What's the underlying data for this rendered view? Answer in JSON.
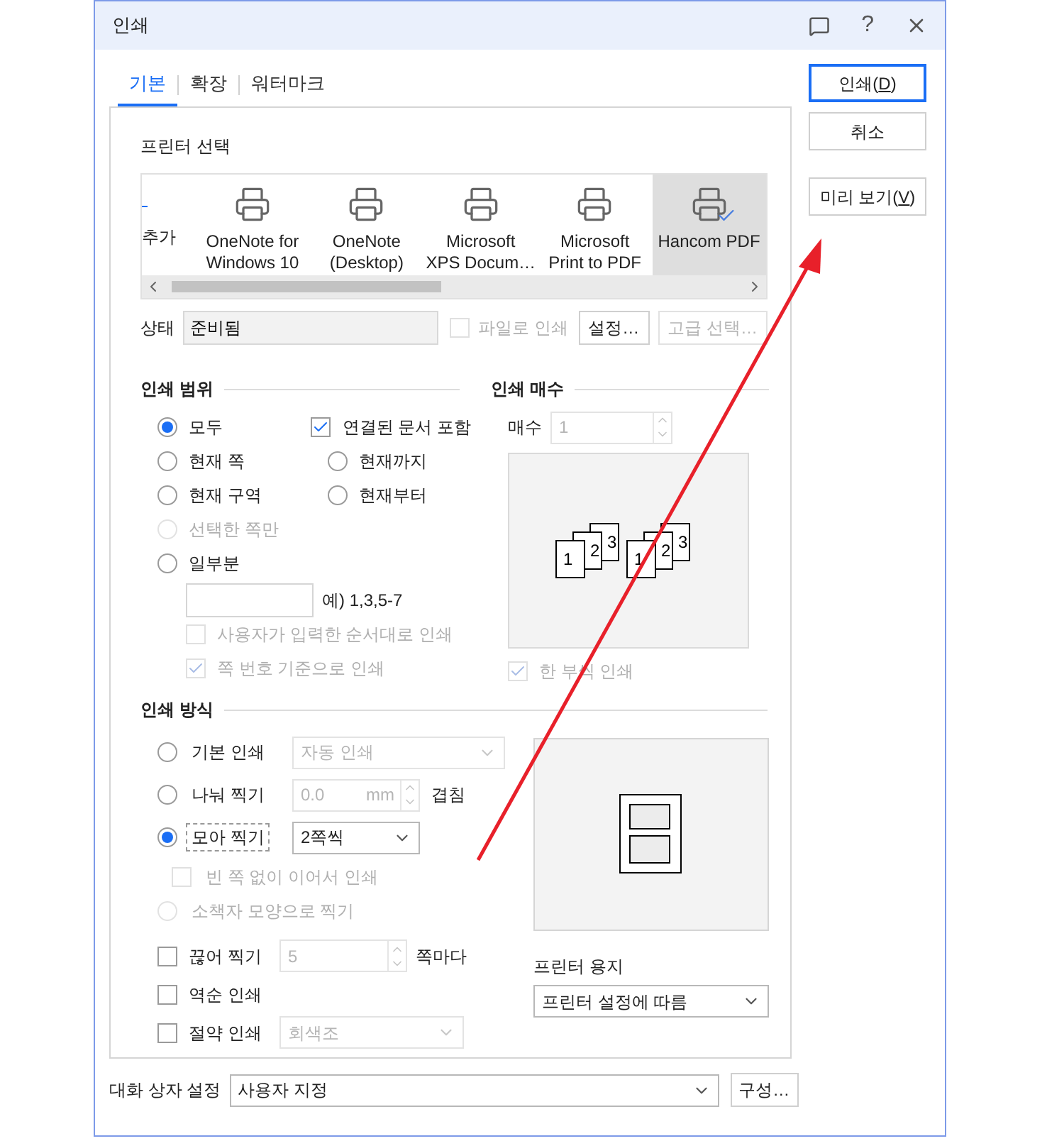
{
  "window": {
    "title": "인쇄",
    "help": "?"
  },
  "tabs": [
    {
      "label": "기본",
      "selected": true
    },
    {
      "label": "확장",
      "selected": false
    },
    {
      "label": "워터마크",
      "selected": false
    }
  ],
  "printer_select": {
    "title": "프린터 선택",
    "printers": [
      {
        "kind": "add",
        "lines": [
          "추가"
        ],
        "selected": false
      },
      {
        "kind": "printer",
        "lines": [
          "OneNote for",
          "Windows 10"
        ],
        "selected": false
      },
      {
        "kind": "printer",
        "lines": [
          "OneNote",
          "(Desktop)"
        ],
        "selected": false
      },
      {
        "kind": "printer",
        "lines": [
          "Microsoft",
          "XPS Docum…"
        ],
        "selected": false
      },
      {
        "kind": "printer",
        "lines": [
          "Microsoft",
          "Print to PDF"
        ],
        "selected": false
      },
      {
        "kind": "printer",
        "lines": [
          "Hancom PDF"
        ],
        "selected": true
      }
    ],
    "status_label": "상태",
    "status": "준비됨",
    "print_to_file": {
      "label": "파일로 인쇄",
      "checked": false,
      "disabled": true
    },
    "settings_button": {
      "label": "설정…",
      "disabled": false
    },
    "advanced_button": {
      "label": "고급 선택…",
      "disabled": true
    }
  },
  "print_range": {
    "title": "인쇄 범위",
    "rows": [
      [
        {
          "kind": "radio",
          "label": "모두",
          "selected": true,
          "disabled": false
        },
        {
          "kind": "checkbox",
          "label": "연결된 문서 포함",
          "checked": true,
          "disabled": false
        }
      ],
      [
        {
          "kind": "radio",
          "label": "현재 쪽",
          "selected": false,
          "disabled": false
        },
        {
          "kind": "radio",
          "label": "현재까지",
          "selected": false,
          "disabled": false
        }
      ],
      [
        {
          "kind": "radio",
          "label": "현재 구역",
          "selected": false,
          "disabled": false
        },
        {
          "kind": "radio",
          "label": "현재부터",
          "selected": false,
          "disabled": false
        }
      ],
      [
        {
          "kind": "radio",
          "label": "선택한 쪽만",
          "selected": false,
          "disabled": true
        }
      ],
      [
        {
          "kind": "radio",
          "label": "일부분",
          "selected": false,
          "disabled": false
        }
      ]
    ],
    "pages_hint": "예) 1,3,5-7",
    "options": [
      {
        "label": "사용자가 입력한 순서대로 인쇄",
        "checked": false,
        "disabled": true
      },
      {
        "label": "쪽 번호 기준으로 인쇄",
        "checked": true,
        "disabled": true
      }
    ]
  },
  "copies": {
    "title": "인쇄 매수",
    "label": "매수",
    "value": "1",
    "stacks": [
      [
        "1",
        "2",
        "3"
      ],
      [
        "1",
        "2",
        "3"
      ]
    ],
    "collate": {
      "label": "한 부씩 인쇄",
      "checked": true,
      "disabled": true
    }
  },
  "print_method": {
    "title": "인쇄 방식",
    "modes": [
      {
        "kind": "select",
        "label": "기본 인쇄",
        "selected": false,
        "disabled": false,
        "value": "자동 인쇄",
        "value_disabled": true
      },
      {
        "kind": "spin",
        "label": "나눠 찍기",
        "selected": false,
        "disabled": false,
        "value": "0.0",
        "unit": "mm",
        "suffix": "겹침",
        "value_disabled": true
      },
      {
        "kind": "select",
        "label": "모아 찍기",
        "selected": true,
        "disabled": false,
        "value": "2쪽씩",
        "value_disabled": false
      },
      {
        "kind": "check",
        "label": "빈 쪽 없이 이어서 인쇄",
        "checked": false,
        "disabled": true
      },
      {
        "kind": "plain",
        "label": "소책자 모양으로 찍기",
        "selected": false,
        "disabled": true
      }
    ],
    "options": [
      {
        "kind": "spin",
        "label": "끊어 찍기",
        "checked": false,
        "value": "5",
        "suffix": "쪽마다"
      },
      {
        "kind": "plain",
        "label": "역순 인쇄",
        "checked": false
      },
      {
        "kind": "select",
        "label": "절약 인쇄",
        "checked": false,
        "value": "회색조"
      }
    ],
    "paper_label": "프린터 용지",
    "paper": "프린터 설정에 따름"
  },
  "footer": {
    "label": "대화 상자 설정",
    "value": "사용자 지정",
    "button": "구성…"
  },
  "buttons": [
    {
      "before": "인쇄(",
      "mnemonic": "D",
      "after": ")",
      "default": true
    },
    {
      "before": "취소",
      "default": false
    },
    {
      "before": "미리 보기(",
      "mnemonic": "V",
      "after": ")",
      "default": false
    }
  ],
  "annotation": {
    "kind": "arrow"
  }
}
